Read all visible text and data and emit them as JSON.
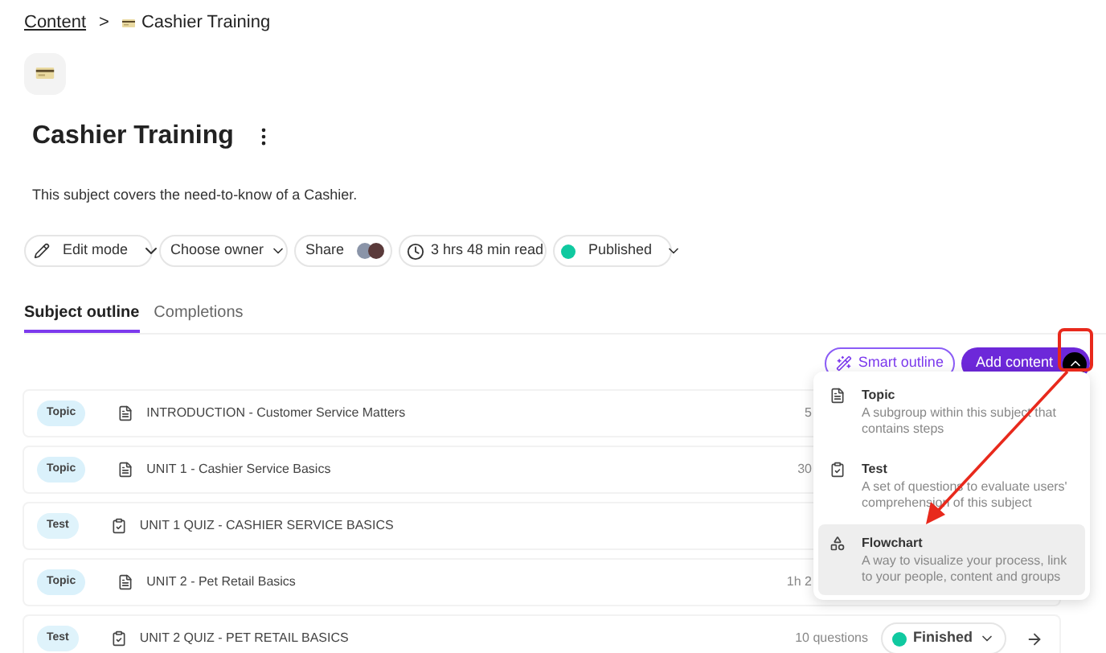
{
  "breadcrumb": {
    "link": "Content",
    "separator": ">",
    "current": "Cashier Training"
  },
  "title": "Cashier Training",
  "description": "This subject covers the need-to-know of a Cashier.",
  "toolbar": {
    "edit": "Edit mode",
    "owner": "Choose owner",
    "share": "Share",
    "read_time": "3 hrs 48 min read",
    "status": {
      "label": "Published",
      "color": "#10c9a0"
    }
  },
  "tabs": [
    {
      "label": "Subject outline",
      "selected": true
    },
    {
      "label": "Completions",
      "selected": false
    }
  ],
  "actions": {
    "smart_outline": "Smart outline",
    "add_content": "Add content",
    "menu_expanded": true
  },
  "rows": [
    {
      "kind": "topic",
      "badge": "Topic",
      "title": "INTRODUCTION - Customer Service Matters",
      "meta": "5"
    },
    {
      "kind": "topic",
      "badge": "Topic",
      "title": "UNIT 1 - Cashier Service Basics",
      "meta": "30"
    },
    {
      "kind": "test",
      "badge": "Test",
      "title": "UNIT 1 QUIZ - CASHIER SERVICE BASICS"
    },
    {
      "kind": "topic",
      "badge": "Topic",
      "title": "UNIT 2 - Pet Retail Basics",
      "meta": "1h 2"
    },
    {
      "kind": "test",
      "badge": "Test",
      "title": "UNIT 2 QUIZ - PET RETAIL BASICS",
      "meta": "10 questions",
      "status": {
        "label": "Finished",
        "color": "#10c9a0"
      }
    }
  ],
  "menu": [
    {
      "kind": "topic",
      "title": "Topic",
      "description": "A subgroup within this subject that contains steps",
      "selected": false
    },
    {
      "kind": "test",
      "title": "Test",
      "description": "A set of questions to evaluate users' comprehension of this subject",
      "selected": false
    },
    {
      "kind": "flowchart",
      "title": "Flowchart",
      "description": "A way to visualize your process, link to your people, content and groups",
      "selected": true
    }
  ]
}
